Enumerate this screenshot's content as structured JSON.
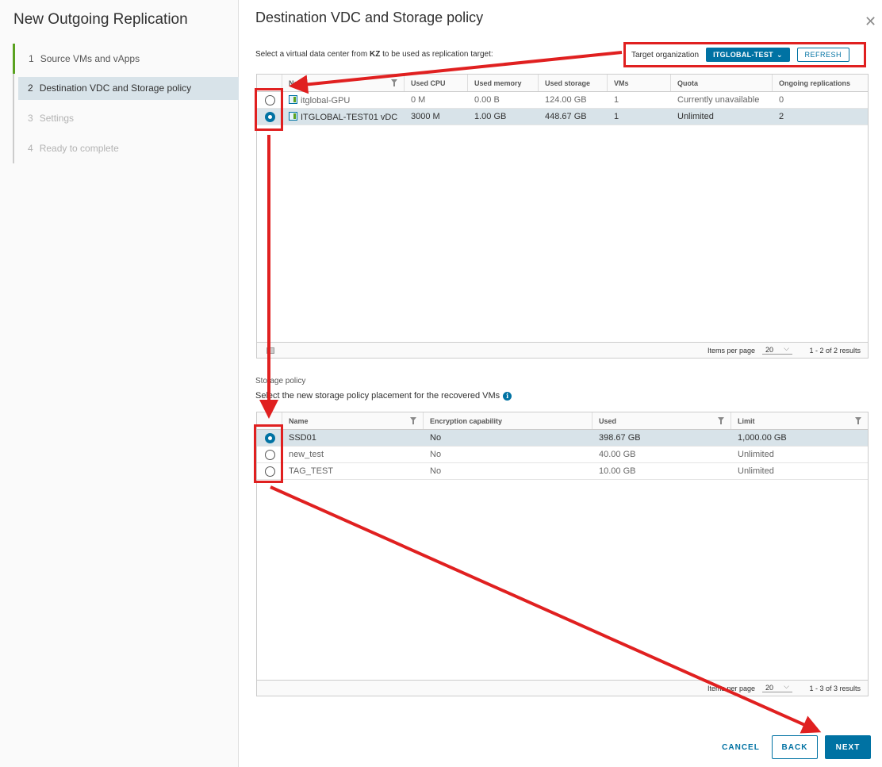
{
  "wizard": {
    "title": "New Outgoing Replication",
    "steps": [
      {
        "num": "1",
        "label": "Source VMs and vApps"
      },
      {
        "num": "2",
        "label": "Destination VDC and Storage policy"
      },
      {
        "num": "3",
        "label": "Settings"
      },
      {
        "num": "4",
        "label": "Ready to complete"
      }
    ]
  },
  "main": {
    "title": "Destination VDC and Storage policy",
    "close_icon": "close-icon",
    "instruction_prefix": "Select a virtual data center from ",
    "instruction_site": "KZ",
    "instruction_suffix": " to be used as replication target:"
  },
  "target_org": {
    "label": "Target organization",
    "value": "ITGLOBAL-TEST",
    "refresh_label": "REFRESH"
  },
  "vdc_grid": {
    "columns": [
      "Name",
      "Used CPU",
      "Used memory",
      "Used storage",
      "VMs",
      "Quota",
      "Ongoing replications"
    ],
    "rows": [
      {
        "name": "itglobal-GPU",
        "cpu": "0 M",
        "memory": "0.00 B",
        "storage": "124.00 GB",
        "vms": "1",
        "quota": "Currently unavailable",
        "ongoing": "0",
        "selected": false
      },
      {
        "name": "ITGLOBAL-TEST01 vDC",
        "cpu": "3000 M",
        "memory": "1.00 GB",
        "storage": "448.67 GB",
        "vms": "1",
        "quota": "Unlimited",
        "ongoing": "2",
        "selected": true
      }
    ],
    "items_per_page_label": "Items per page",
    "items_per_page": "20",
    "results": "1 - 2 of 2 results"
  },
  "storage": {
    "section_label": "Storage policy",
    "instruction": "Select the new storage policy placement for the recovered VMs",
    "columns": [
      "Name",
      "Encryption capability",
      "Used",
      "Limit"
    ],
    "rows": [
      {
        "name": "SSD01",
        "encryption": "No",
        "used": "398.67 GB",
        "limit": "1,000.00 GB",
        "selected": true
      },
      {
        "name": "new_test",
        "encryption": "No",
        "used": "40.00 GB",
        "limit": "Unlimited",
        "selected": false
      },
      {
        "name": "TAG_TEST",
        "encryption": "No",
        "used": "10.00 GB",
        "limit": "Unlimited",
        "selected": false
      }
    ],
    "items_per_page_label": "Items per page",
    "items_per_page": "20",
    "results": "1 - 3 of 3 results"
  },
  "footer": {
    "cancel": "CANCEL",
    "back": "BACK",
    "next": "NEXT"
  },
  "colors": {
    "accent": "#0072a3",
    "selected_row": "#d8e3e9",
    "annotation": "#e02020",
    "step_done": "#5aa220"
  }
}
